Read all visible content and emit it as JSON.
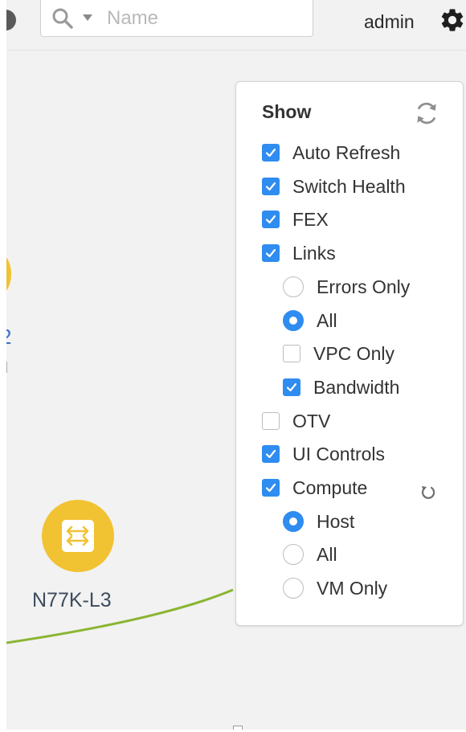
{
  "header": {
    "search": {
      "placeholder": "Name",
      "value": ""
    },
    "username": "admin"
  },
  "topology": {
    "node_label": "N77K-L3",
    "partial_label": "2"
  },
  "panel": {
    "title": "Show",
    "options": [
      {
        "label": "Auto Refresh",
        "control": "checkbox",
        "checked": true
      },
      {
        "label": "Switch Health",
        "control": "checkbox",
        "checked": true
      },
      {
        "label": "FEX",
        "control": "checkbox",
        "checked": true
      },
      {
        "label": "Links",
        "control": "checkbox",
        "checked": true
      },
      {
        "label": "Errors Only",
        "control": "radio",
        "checked": false
      },
      {
        "label": "All",
        "control": "radio",
        "checked": true
      },
      {
        "label": "VPC Only",
        "control": "checkbox",
        "checked": false
      },
      {
        "label": "Bandwidth",
        "control": "checkbox",
        "checked": true
      },
      {
        "label": "OTV",
        "control": "checkbox",
        "checked": false
      },
      {
        "label": "UI Controls",
        "control": "checkbox",
        "checked": true
      },
      {
        "label": "Compute",
        "control": "checkbox",
        "checked": true
      },
      {
        "label": "Host",
        "control": "radio",
        "checked": true
      },
      {
        "label": "All",
        "control": "radio",
        "checked": false
      },
      {
        "label": "VM Only",
        "control": "radio",
        "checked": false
      }
    ]
  },
  "colors": {
    "accent": "#2f8cf0",
    "node": "#f1c232",
    "link": "#8ab531"
  }
}
